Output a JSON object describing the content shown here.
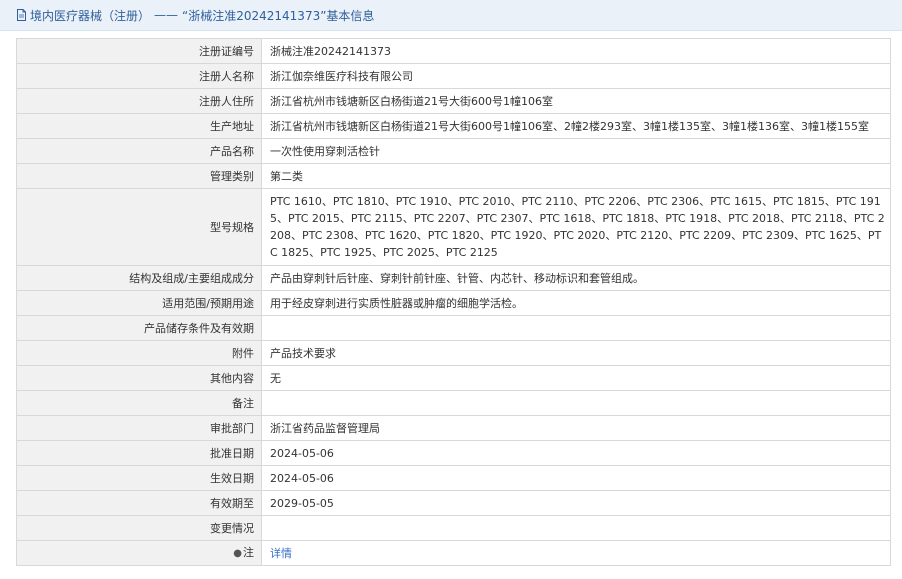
{
  "header": {
    "category": "境内医疗器械（注册）",
    "dash": "——",
    "title": "“浙械注准20242141373”基本信息"
  },
  "rows": [
    {
      "key": "注册证编号",
      "value": "浙械注准20242141373"
    },
    {
      "key": "注册人名称",
      "value": "浙江伽奈维医疗科技有限公司"
    },
    {
      "key": "注册人住所",
      "value": "浙江省杭州市钱塘新区白杨街道21号大街600号1幢106室"
    },
    {
      "key": "生产地址",
      "value": "浙江省杭州市钱塘新区白杨街道21号大街600号1幢106室、2幢2楼293室、3幢1楼135室、3幢1楼136室、3幢1楼155室"
    },
    {
      "key": "产品名称",
      "value": "一次性使用穿刺活检针"
    },
    {
      "key": "管理类别",
      "value": "第二类"
    },
    {
      "key": "型号规格",
      "value": "PTC 1610、PTC 1810、PTC 1910、PTC 2010、PTC 2110、PTC 2206、PTC 2306、PTC 1615、PTC 1815、PTC 1915、PTC 2015、PTC 2115、PTC 2207、PTC 2307、PTC 1618、PTC 1818、PTC 1918、PTC 2018、PTC 2118、PTC 2208、PTC 2308、PTC 1620、PTC 1820、PTC 1920、PTC 2020、PTC 2120、PTC 2209、PTC 2309、PTC 1625、PTC 1825、PTC 1925、PTC 2025、PTC 2125"
    },
    {
      "key": "结构及组成/主要组成成分",
      "value": "产品由穿刺针后针座、穿刺针前针座、针管、内芯针、移动标识和套管组成。"
    },
    {
      "key": "适用范围/预期用途",
      "value": "用于经皮穿刺进行实质性脏器或肿瘤的细胞学活检。"
    },
    {
      "key": "产品储存条件及有效期",
      "value": ""
    },
    {
      "key": "附件",
      "value": "产品技术要求"
    },
    {
      "key": "其他内容",
      "value": "无"
    },
    {
      "key": "备注",
      "value": ""
    },
    {
      "key": "审批部门",
      "value": "浙江省药品监督管理局"
    },
    {
      "key": "批准日期",
      "value": "2024-05-06"
    },
    {
      "key": "生效日期",
      "value": "2024-05-06"
    },
    {
      "key": "有效期至",
      "value": "2029-05-05"
    },
    {
      "key": "变更情况",
      "value": ""
    },
    {
      "key": "注",
      "value": "详情"
    }
  ]
}
